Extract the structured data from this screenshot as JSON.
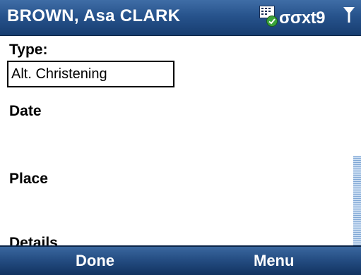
{
  "titlebar": {
    "title": "BROWN, Asa CLARK",
    "indicator_text": "xt9",
    "icons": [
      "grid-icon",
      "check-icon",
      "voicemail-icon",
      "signal-icon"
    ],
    "accent_color": "#27538c"
  },
  "form": {
    "type_label": "Type:",
    "type_value": "Alt. Christening",
    "date_label": "Date",
    "place_label": "Place",
    "details_label": "Details"
  },
  "softkeys": {
    "left": "Done",
    "right": "Menu"
  }
}
